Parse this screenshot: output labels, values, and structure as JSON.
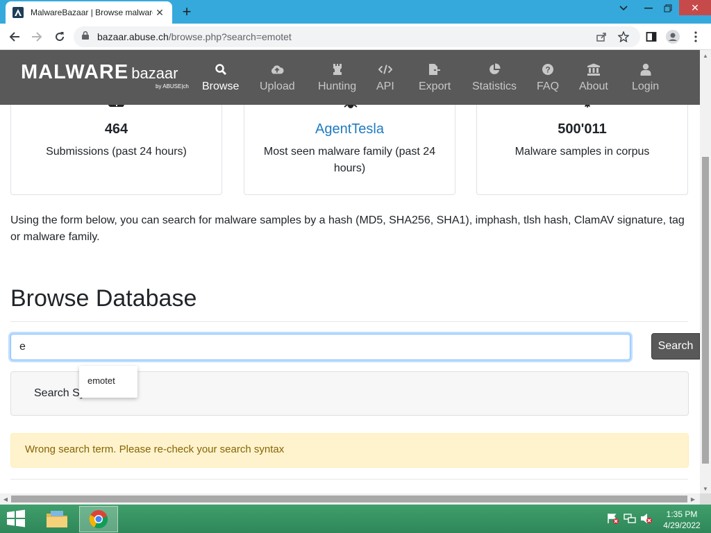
{
  "browser": {
    "tab_title": "MalwareBazaar | Browse malware",
    "url_host": "bazaar.abuse.ch",
    "url_path": "/browse.php?search=emotet"
  },
  "site": {
    "logo_main": "MALWARE",
    "logo_bazaar": "bazaar",
    "logo_sub": "by ABUSE|ch",
    "nav": [
      {
        "label": "Browse",
        "icon": "search-icon",
        "active": true
      },
      {
        "label": "Upload",
        "icon": "cloud-upload-icon"
      },
      {
        "label": "Hunting",
        "icon": "chess-rook-icon"
      },
      {
        "label": "API",
        "icon": "code-icon"
      },
      {
        "label": "Export",
        "icon": "file-export-icon"
      },
      {
        "label": "Statistics",
        "icon": "pie-chart-icon"
      },
      {
        "label": "FAQ",
        "icon": "question-circle-icon"
      },
      {
        "label": "About",
        "icon": "landmark-icon"
      },
      {
        "label": "Login",
        "icon": "user-icon"
      }
    ]
  },
  "stats": [
    {
      "value": "464",
      "description": "Submissions (past 24 hours)"
    },
    {
      "value": "AgentTesla",
      "description": "Most seen malware family (past 24 hours)"
    },
    {
      "value": "500'011",
      "description": "Malware samples in corpus"
    }
  ],
  "intro_text": "Using the form below, you can search for malware samples by a hash (MD5, SHA256, SHA1), imphash, tlsh hash, ClamAV signature, tag or malware family.",
  "browse": {
    "heading": "Browse Database",
    "search_value": "e",
    "search_button": "Search",
    "autocomplete_suggestion": "emotet",
    "syntax_label": "Search Syntax",
    "alert_text": "Wrong search term. Please re-check your search syntax"
  },
  "taskbar": {
    "time": "1:35 PM",
    "date": "4/29/2022"
  },
  "colors": {
    "tabstrip": "#35a9dc",
    "site_header": "#595959",
    "link": "#1f7bc0",
    "alert_bg": "#fff3cd",
    "taskbar": "#2f8759"
  }
}
